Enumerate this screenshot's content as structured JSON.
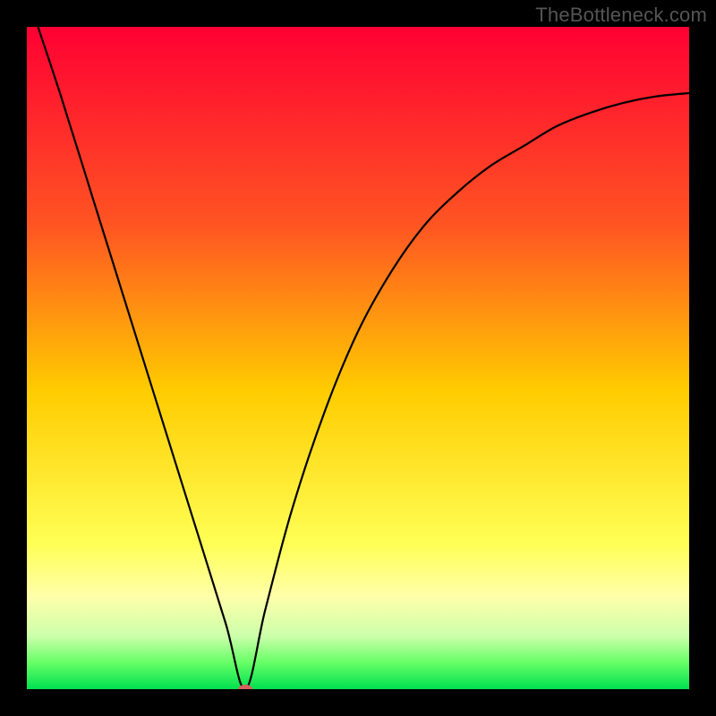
{
  "watermark": "TheBottleneck.com",
  "chart_data": {
    "type": "line",
    "title": "",
    "xlabel": "",
    "ylabel": "",
    "xlim": [
      0,
      100
    ],
    "ylim": [
      0,
      100
    ],
    "minimum_x": 33,
    "grid": false,
    "gradient_stops": [
      {
        "offset": 0,
        "color": "#ff0033"
      },
      {
        "offset": 30,
        "color": "#ff5522"
      },
      {
        "offset": 55,
        "color": "#ffcc00"
      },
      {
        "offset": 78,
        "color": "#ffff55"
      },
      {
        "offset": 86,
        "color": "#ffffaa"
      },
      {
        "offset": 92,
        "color": "#ccffaa"
      },
      {
        "offset": 96,
        "color": "#66ff66"
      },
      {
        "offset": 100,
        "color": "#00e050"
      }
    ],
    "series": [
      {
        "name": "bottleneck-curve",
        "x": [
          0,
          5,
          10,
          15,
          20,
          25,
          30,
          33,
          36,
          40,
          45,
          50,
          55,
          60,
          65,
          70,
          75,
          80,
          85,
          90,
          95,
          100
        ],
        "y": [
          105,
          90,
          74,
          58,
          42,
          26,
          10,
          0,
          12,
          27,
          42,
          54,
          63,
          70,
          75,
          79,
          82,
          85,
          87,
          88.5,
          89.5,
          90
        ]
      }
    ],
    "minimum_marker": {
      "x": 33,
      "y": 0,
      "color": "#d96060",
      "rx": 8,
      "ry": 5
    }
  }
}
